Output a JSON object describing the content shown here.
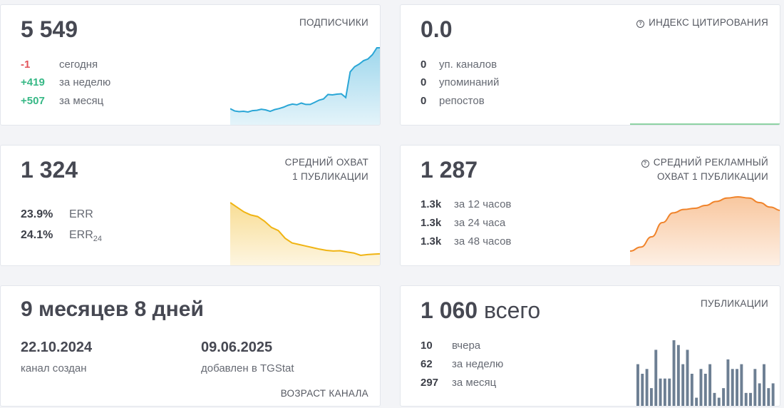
{
  "subscribers": {
    "value": "5 549",
    "title": "ПОДПИСЧИКИ",
    "stats": [
      {
        "value": "-1",
        "label": "сегодня",
        "tone": "red"
      },
      {
        "value": "+419",
        "label": "за неделю",
        "tone": "green"
      },
      {
        "value": "+507",
        "label": "за месяц",
        "tone": "green"
      }
    ]
  },
  "citation": {
    "value": "0.0",
    "title": "ИНДЕКС ЦИТИРОВАНИЯ",
    "info_icon": "info-circle-icon",
    "stats": [
      {
        "value": "0",
        "label": "уп. каналов"
      },
      {
        "value": "0",
        "label": "упоминаний"
      },
      {
        "value": "0",
        "label": "репостов"
      }
    ]
  },
  "reach": {
    "value": "1 324",
    "title_line1": "СРЕДНИЙ ОХВАТ",
    "title_line2": "1 ПУБЛИКАЦИИ",
    "stats": [
      {
        "value": "23.9%",
        "label": "ERR",
        "sub": ""
      },
      {
        "value": "24.1%",
        "label": "ERR",
        "sub": "24"
      }
    ]
  },
  "ad_reach": {
    "value": "1 287",
    "title_line1": "СРЕДНИЙ РЕКЛАМНЫЙ",
    "title_line2": "ОХВАТ 1 ПУБЛИКАЦИИ",
    "info_icon": "info-circle-icon",
    "stats": [
      {
        "value": "1.3k",
        "label": "за 12 часов"
      },
      {
        "value": "1.3k",
        "label": "за 24 часа"
      },
      {
        "value": "1.3k",
        "label": "за 48 часов"
      }
    ]
  },
  "age": {
    "value": "9 месяцев 8 дней",
    "created_date": "22.10.2024",
    "created_label": "канал создан",
    "added_date": "09.06.2025",
    "added_label": "добавлен в TGStat",
    "title": "ВОЗРАСТ КАНАЛА"
  },
  "posts": {
    "value_number": "1 060",
    "value_suffix": "всего",
    "title": "ПУБЛИКАЦИИ",
    "stats": [
      {
        "value": "10",
        "label": "вчера"
      },
      {
        "value": "62",
        "label": "за неделю"
      },
      {
        "value": "297",
        "label": "за месяц"
      }
    ]
  },
  "chart_data": [
    {
      "type": "area",
      "title": "ПОДПИСЧИКИ",
      "color": "#2aa6d6",
      "values": [
        5065,
        5052,
        5048,
        5050,
        5046,
        5054,
        5056,
        5062,
        5058,
        5050,
        5060,
        5066,
        5074,
        5085,
        5092,
        5088,
        5098,
        5090,
        5090,
        5102,
        5115,
        5122,
        5148,
        5146,
        5150,
        5152,
        5130,
        5280,
        5310,
        5325,
        5345,
        5355,
        5380,
        5420,
        5420
      ]
    },
    {
      "type": "area",
      "title": "СРЕДНИЙ ОХВАТ 1 ПУБЛИКАЦИИ",
      "color": "#f0b413",
      "values": [
        1880,
        1850,
        1820,
        1800,
        1790,
        1760,
        1720,
        1700,
        1650,
        1620,
        1610,
        1600,
        1590,
        1580,
        1572,
        1568,
        1570,
        1562,
        1555,
        1540,
        1545,
        1548,
        1550
      ]
    },
    {
      "type": "area",
      "title": "СРЕДНИЙ РЕКЛАМНЫЙ ОХВАТ 1 ПУБЛИКАЦИИ",
      "color": "#f0832a",
      "values": [
        0.05,
        0.12,
        0.3,
        0.55,
        0.72,
        0.78,
        0.8,
        0.85,
        0.92,
        0.98,
        1.0,
        0.98,
        0.9,
        0.82,
        0.76
      ]
    },
    {
      "type": "bar",
      "title": "ПУБЛИКАЦИИ",
      "color": "#6d7f93",
      "values": [
        9,
        7,
        8,
        4,
        12,
        6,
        6,
        6,
        14,
        13,
        9,
        12,
        7,
        2,
        8,
        7,
        9,
        3,
        2,
        4,
        10,
        8,
        8,
        9,
        3,
        3,
        8,
        5,
        9,
        4,
        5
      ]
    }
  ]
}
